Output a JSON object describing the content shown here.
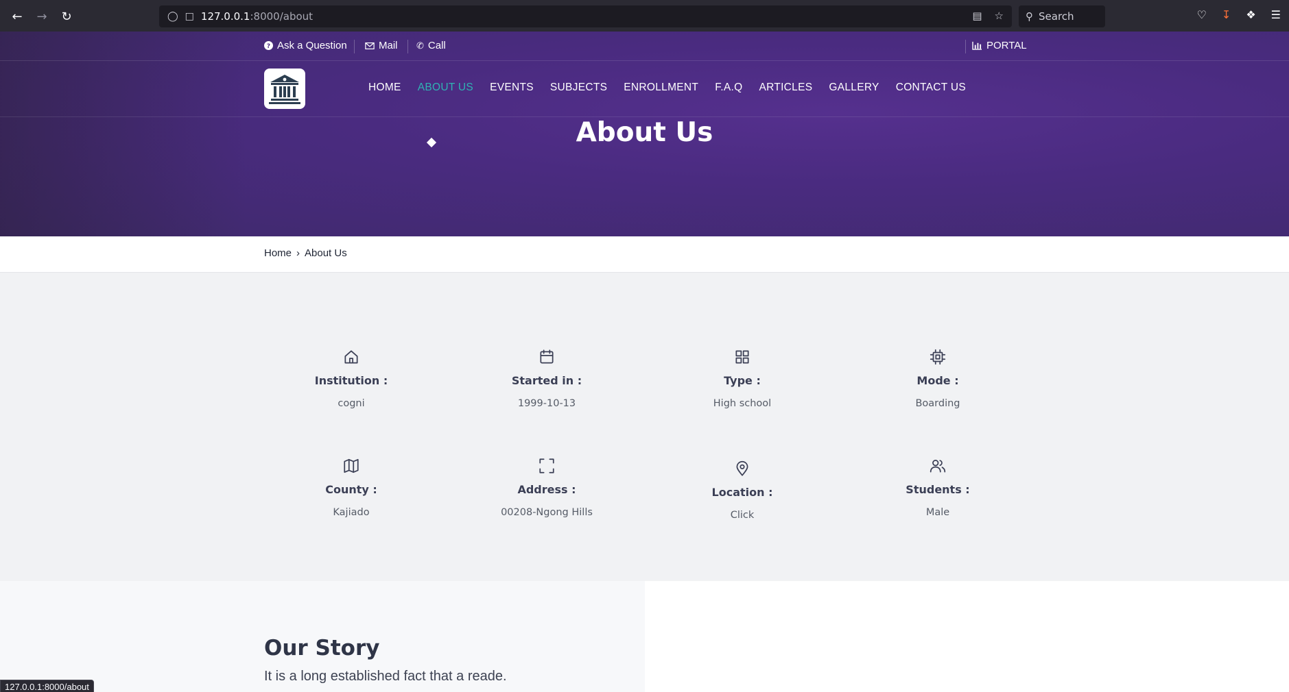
{
  "browser": {
    "url_host": "127.0.0.1",
    "url_path": ":8000/about",
    "search_placeholder": "Search",
    "status_url": "127.0.0.1:8000/about"
  },
  "topbar": {
    "ask": "Ask a Question",
    "mail": "Mail",
    "call": "Call",
    "portal": "PORTAL"
  },
  "nav": {
    "items": [
      "HOME",
      "ABOUT US",
      "EVENTS",
      "SUBJECTS",
      "ENROLLMENT",
      "F.A.Q",
      "ARTICLES",
      "GALLERY",
      "CONTACT US"
    ],
    "active": "ABOUT US"
  },
  "hero": {
    "title": "About Us"
  },
  "breadcrumb": {
    "home": "Home",
    "sep": "›",
    "current": "About Us"
  },
  "info": [
    {
      "icon": "home-icon",
      "label": "Institution :",
      "value": "cogni"
    },
    {
      "icon": "calendar-icon",
      "label": "Started in :",
      "value": "1999-10-13"
    },
    {
      "icon": "grid-icon",
      "label": "Type :",
      "value": "High school"
    },
    {
      "icon": "cpu-icon",
      "label": "Mode :",
      "value": "Boarding"
    },
    {
      "icon": "map-icon",
      "label": "County :",
      "value": "Kajiado"
    },
    {
      "icon": "maximize-icon",
      "label": "Address :",
      "value": "00208-Ngong Hills"
    },
    {
      "icon": "map-pin-icon",
      "label": "Location :",
      "value": "Click"
    },
    {
      "icon": "users-icon",
      "label": "Students :",
      "value": "Male"
    }
  ],
  "story": {
    "title": "Our Story",
    "text": "It is a long established fact that a reade."
  }
}
